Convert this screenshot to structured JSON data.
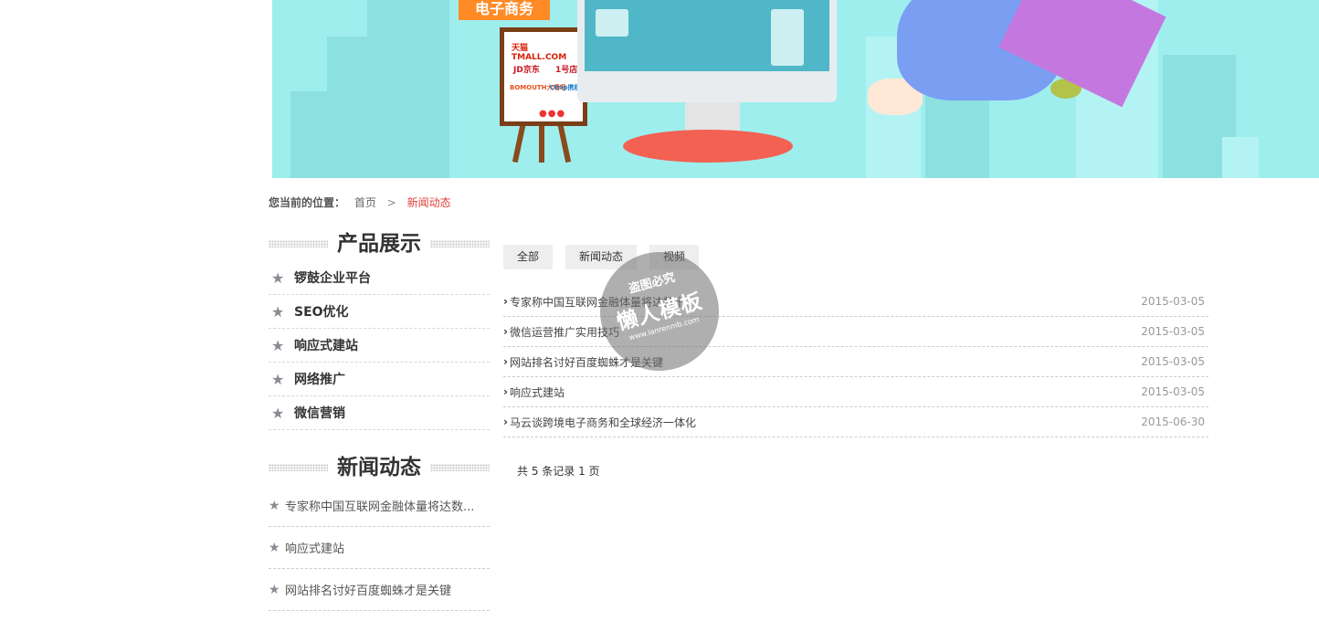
{
  "banner": {
    "tag": "电子商务",
    "logos": [
      "天猫TMALL.COM",
      "JD京东",
      "1号店",
      "BOMOUTH大嘴吧",
      "Ctrip携程"
    ],
    "colors": {
      "sky": "#9eeeee",
      "tag": "#ff8a26",
      "stand": "#f26152",
      "bag": "#c577e0"
    }
  },
  "breadcrumb": {
    "label": "您当前的位置：",
    "home": "首页",
    "separator": ">",
    "current": "新闻动态",
    "current_color": "#e0403a"
  },
  "sidebar": {
    "products_title": "产品展示",
    "products": [
      "锣鼓企业平台",
      "SEO优化",
      "响应式建站",
      "网络推广",
      "微信营销"
    ],
    "news_title": "新闻动态",
    "news": [
      "专家称中国互联网金融体量将达数...",
      "响应式建站",
      "网站排名讨好百度蜘蛛才是关键"
    ]
  },
  "main": {
    "tabs": [
      "全部",
      "新闻动态",
      "视频"
    ],
    "news": [
      {
        "title": "专家称中国互联网金融体量将达数十...",
        "date": "2015-03-05"
      },
      {
        "title": "微信运营推广实用技巧",
        "date": "2015-03-05"
      },
      {
        "title": "网站排名讨好百度蜘蛛才是关键",
        "date": "2015-03-05"
      },
      {
        "title": "响应式建站",
        "date": "2015-03-05"
      },
      {
        "title": "马云谈跨境电子商务和全球经济一体化",
        "date": "2015-06-30"
      }
    ],
    "pager": "共 5 条记录 1 页"
  },
  "watermark": {
    "line1": "盗图必究",
    "line2": "懒人模板",
    "line3": "www.lanrenmb.com"
  }
}
